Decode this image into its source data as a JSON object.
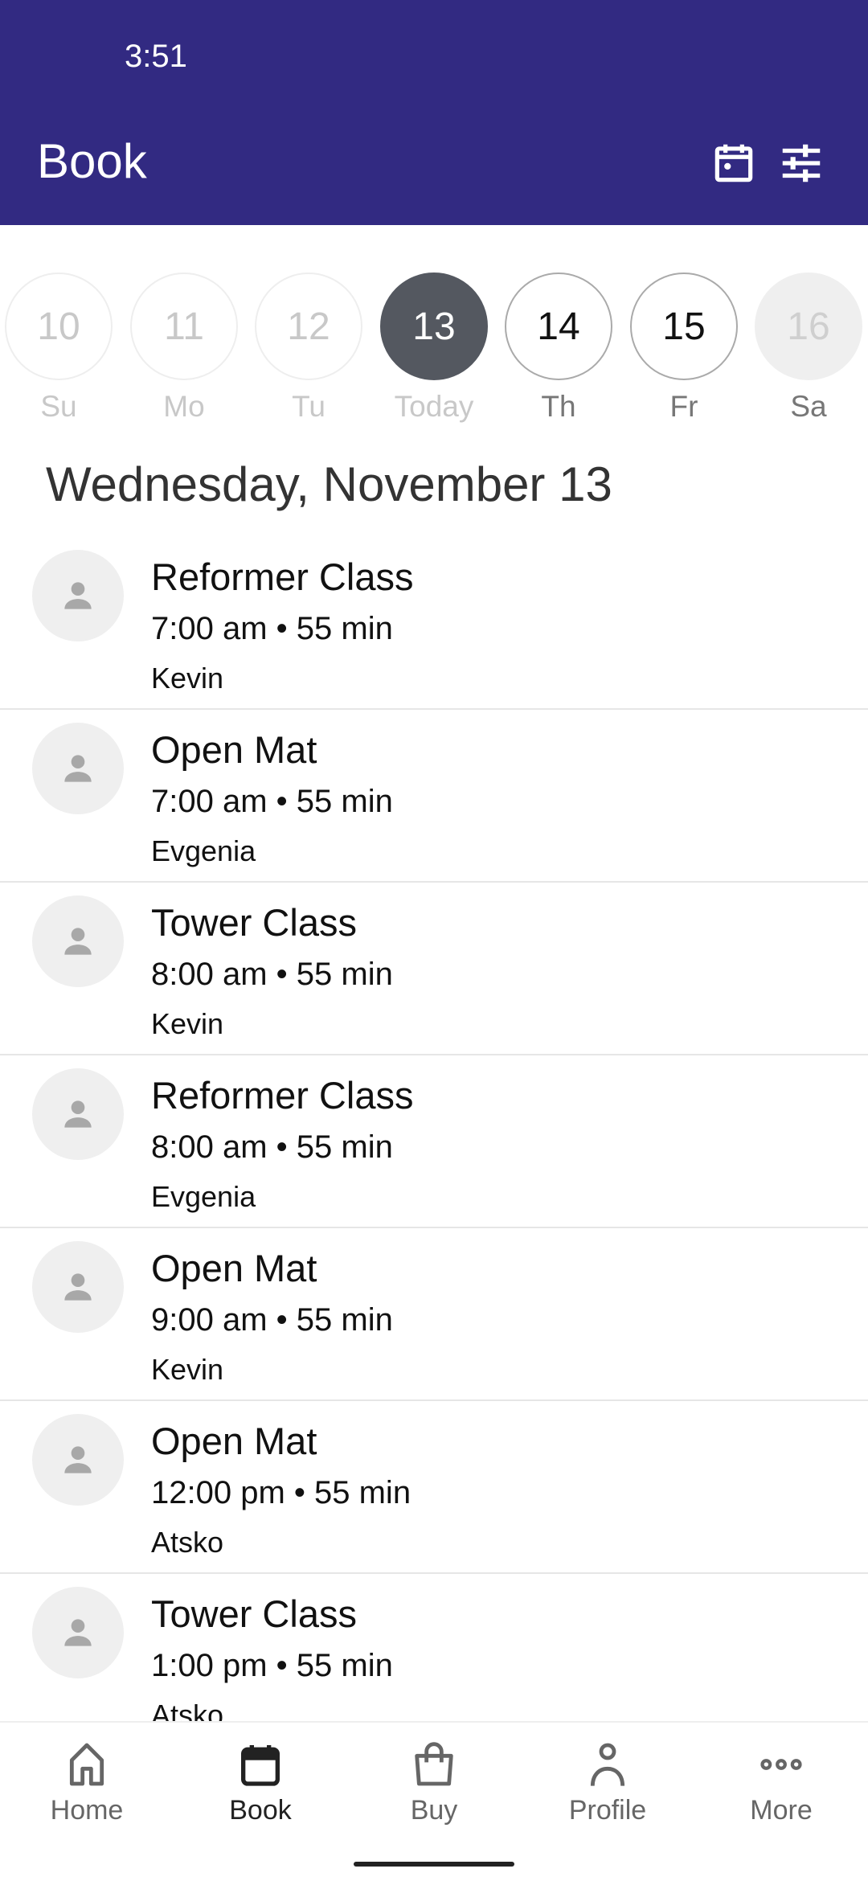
{
  "status_bar": {
    "time": "3:51"
  },
  "header": {
    "title": "Book",
    "icons": [
      "calendar-icon",
      "filter-sliders-icon"
    ],
    "bg_color": "#322a82"
  },
  "date_strip": [
    {
      "num": "10",
      "label": "Su",
      "state": "past"
    },
    {
      "num": "11",
      "label": "Mo",
      "state": "past"
    },
    {
      "num": "12",
      "label": "Tu",
      "state": "past"
    },
    {
      "num": "13",
      "label": "Today",
      "state": "selected"
    },
    {
      "num": "14",
      "label": "Th",
      "state": "future"
    },
    {
      "num": "15",
      "label": "Fr",
      "state": "future"
    },
    {
      "num": "16",
      "label": "Sa",
      "state": "disabled"
    }
  ],
  "date_heading": "Wednesday, November 13",
  "classes": [
    {
      "title": "Reformer Class",
      "time": "7:00 am • 55 min",
      "instructor": "Kevin"
    },
    {
      "title": "Open Mat",
      "time": "7:00 am • 55 min",
      "instructor": "Evgenia"
    },
    {
      "title": "Tower Class",
      "time": "8:00 am • 55 min",
      "instructor": "Kevin"
    },
    {
      "title": "Reformer Class",
      "time": "8:00 am • 55 min",
      "instructor": "Evgenia"
    },
    {
      "title": "Open Mat",
      "time": "9:00 am • 55 min",
      "instructor": "Kevin"
    },
    {
      "title": "Open Mat",
      "time": "12:00 pm • 55 min",
      "instructor": "Atsko"
    },
    {
      "title": "Tower Class",
      "time": "1:00 pm • 55 min",
      "instructor": "Atsko"
    }
  ],
  "bottom_nav": [
    {
      "label": "Home",
      "icon": "home-icon"
    },
    {
      "label": "Book",
      "icon": "calendar-icon",
      "active": true
    },
    {
      "label": "Buy",
      "icon": "shopping-bag-icon"
    },
    {
      "label": "Profile",
      "icon": "person-icon"
    },
    {
      "label": "More",
      "icon": "more-dots-icon"
    }
  ]
}
